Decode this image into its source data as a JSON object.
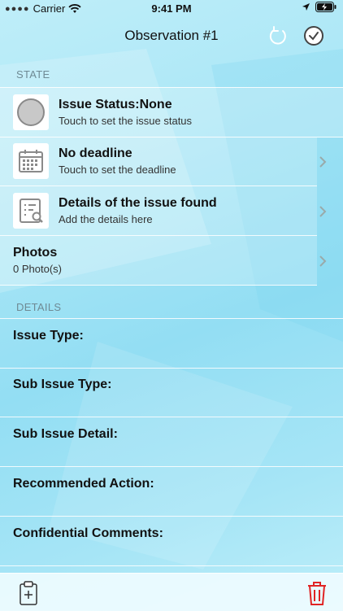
{
  "status_bar": {
    "carrier": "Carrier",
    "time": "9:41 PM"
  },
  "navbar": {
    "title": "Observation #1"
  },
  "sections": {
    "state": "STATE",
    "details": "DETAILS"
  },
  "state_rows": [
    {
      "title": "Issue Status:None",
      "subtitle": "Touch to set the issue status",
      "icon": "gray-circle-icon"
    },
    {
      "title": "No deadline",
      "subtitle": "Touch to set the deadline",
      "icon": "calendar-icon"
    },
    {
      "title": "Details of the issue found",
      "subtitle": "Add the details here",
      "icon": "list-search-icon"
    },
    {
      "title": "Photos",
      "subtitle": "0 Photo(s)"
    }
  ],
  "detail_fields": [
    {
      "label": "Issue Type:"
    },
    {
      "label": "Sub Issue Type:"
    },
    {
      "label": "Sub Issue Detail:"
    },
    {
      "label": "Recommended Action:"
    },
    {
      "label": "Confidential Comments:"
    }
  ],
  "colors": {
    "accent": "#0a84ff",
    "delete": "#e02424",
    "icon_gray": "#8a8a8a"
  }
}
